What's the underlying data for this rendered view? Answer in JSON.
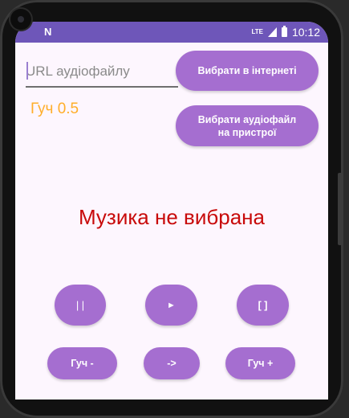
{
  "status_bar": {
    "notification_icon": "N",
    "network_label": "LTE",
    "signal_icon": "signal-icon",
    "battery_icon": "battery-icon",
    "time": "10:12"
  },
  "colors": {
    "status_bar": "#6e56b9",
    "background": "#fdf6fe",
    "button": "#a56ed0",
    "volume_text": "#ffae2a",
    "status_text": "#c80a0a"
  },
  "url_input": {
    "placeholder": "URL аудіофайлу",
    "value": ""
  },
  "buttons": {
    "pick_internet": "Вибрати в інтернеті",
    "pick_device": "Вибрати аудіофайл на пристрої",
    "pause": "| |",
    "play": "►",
    "stop": "[ ]",
    "volume_down": "Гуч -",
    "next": "->",
    "volume_up": "Гуч +"
  },
  "volume_label": "Гуч 0.5",
  "status_text": "Музика не вибрана"
}
